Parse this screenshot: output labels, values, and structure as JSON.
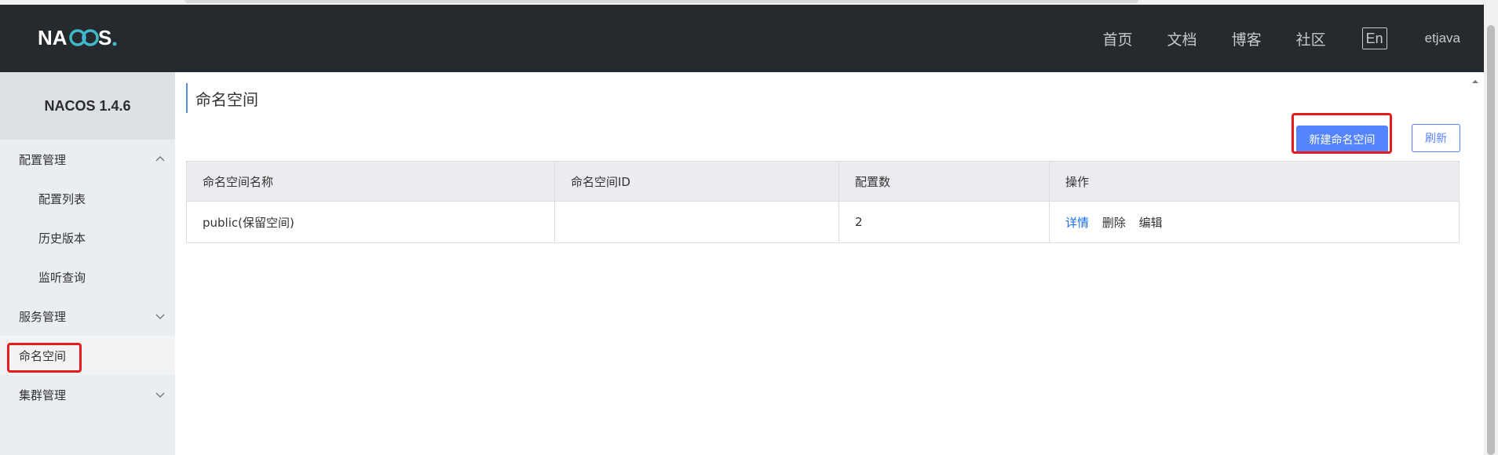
{
  "header": {
    "logo_text": "NACOS.",
    "nav": [
      "首页",
      "文档",
      "博客",
      "社区"
    ],
    "lang": "En",
    "user": "etjava"
  },
  "sidebar": {
    "version": "NACOS 1.4.6",
    "items": [
      {
        "label": "配置管理",
        "level": "top",
        "icon": "chevron-up-icon"
      },
      {
        "label": "配置列表",
        "level": "sub"
      },
      {
        "label": "历史版本",
        "level": "sub"
      },
      {
        "label": "监听查询",
        "level": "sub"
      },
      {
        "label": "服务管理",
        "level": "top",
        "icon": "chevron-down-icon"
      },
      {
        "label": "命名空间",
        "level": "top",
        "active": true
      },
      {
        "label": "集群管理",
        "level": "top",
        "icon": "chevron-down-icon"
      }
    ]
  },
  "main": {
    "title": "命名空间",
    "create_button": "新建命名空间",
    "refresh_button": "刷新",
    "table": {
      "headers": [
        "命名空间名称",
        "命名空间ID",
        "配置数",
        "操作"
      ],
      "rows": [
        {
          "name": "public(保留空间)",
          "id": "",
          "count": "2",
          "ops": [
            "详情",
            "删除",
            "编辑"
          ]
        }
      ]
    }
  },
  "colors": {
    "header_bg": "#252a2f",
    "sidebar_bg": "#eaedf1",
    "primary": "#5584ff",
    "highlight_box": "#e51c1c",
    "link": "#1a6fe8"
  }
}
